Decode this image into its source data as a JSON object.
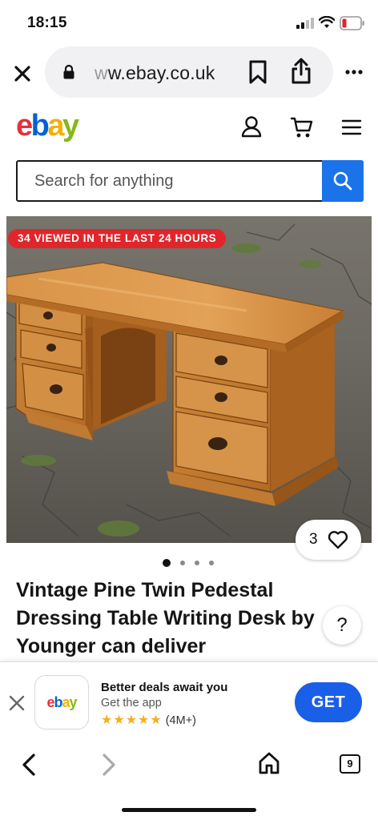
{
  "status_bar": {
    "time": "18:15"
  },
  "browser": {
    "url_prefix": "w",
    "url_main": "w.ebay.co.uk",
    "tabs_count": "9"
  },
  "header": {
    "logo_letters": [
      "e",
      "b",
      "a",
      "y"
    ],
    "logo_colors": [
      "#e53238",
      "#0064d2",
      "#f5af02",
      "#86b817"
    ]
  },
  "search": {
    "placeholder": "Search for anything"
  },
  "listing": {
    "viewed_badge": "34 VIEWED IN THE LAST 24 HOURS",
    "watch_count": "3",
    "image_count": 4,
    "active_image": 1,
    "title": "Vintage Pine Twin Pedestal Dressing Table Writing Desk by Younger can deliver",
    "help": "?"
  },
  "app_banner": {
    "logo_text": "ebay",
    "headline": "Better deals await you",
    "subline": "Get the app",
    "stars": "★★★★★",
    "review_count": "(4M+)",
    "get_label": "GET"
  },
  "colors": {
    "search_blue": "#1a73e8",
    "badge_red": "#e0262b",
    "get_blue": "#1a5fe8",
    "star_gold": "#f2b01e"
  }
}
